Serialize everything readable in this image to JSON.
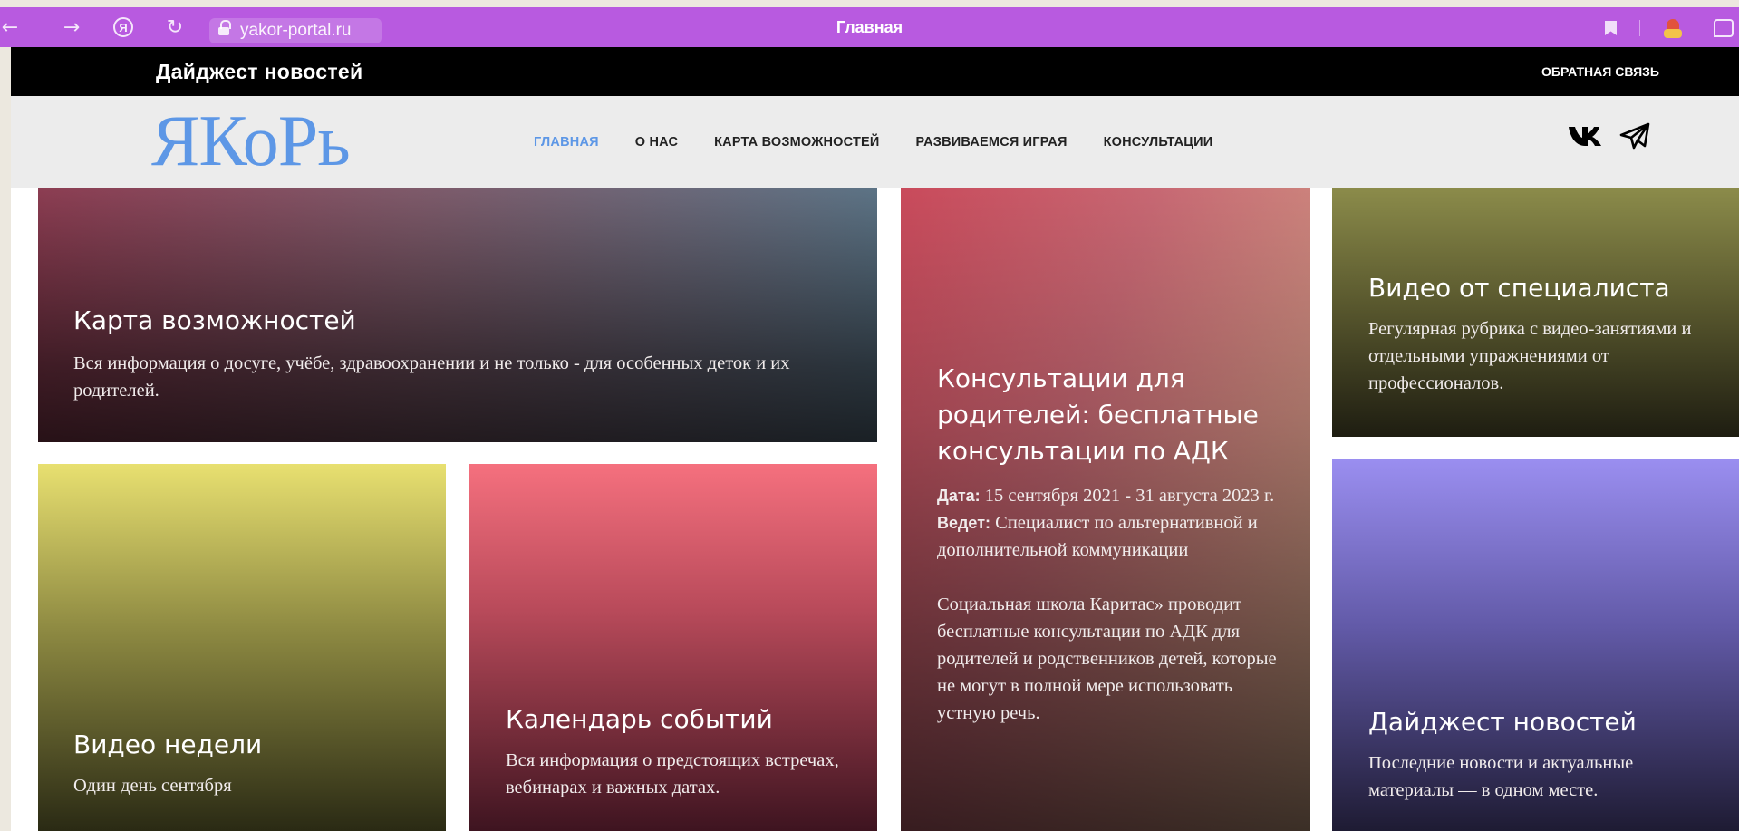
{
  "browser": {
    "url": "yakor-portal.ru",
    "tab_title": "Главная"
  },
  "topbar": {
    "title": "Дайджест новостей",
    "feedback": "ОБРАТНАЯ СВЯЗЬ"
  },
  "logo": "ЯКоРь",
  "nav": [
    {
      "label": "ГЛАВНАЯ",
      "active": true
    },
    {
      "label": "О НАС"
    },
    {
      "label": "КАРТА ВОЗМОЖНОСТЕЙ"
    },
    {
      "label": "РАЗВИВАЕМСЯ ИГРАЯ"
    },
    {
      "label": "КОНСУЛЬТАЦИИ"
    }
  ],
  "social": {
    "vk_label": "VK",
    "accent": "#5d97e6"
  },
  "cards": {
    "map": {
      "title": "Карта возможностей",
      "text": "Вся информация о досуге, учёбе, здравоохранении и не только - для особенных деток и их родителей."
    },
    "consult": {
      "title": "Консультации для родителей: бесплатные консультации по АДК",
      "date_label": "Дата:",
      "date_value": " 15 сентября 2021 - 31 августа 2023 г.",
      "host_label": "Ведет:",
      "host_value": " Специалист по альтернативной и дополнительной коммуникации",
      "description": "Социальная школа Каритас» проводит бесплатные консультации по АДК для родителей и родственников детей, которые не могут в полной мере использовать устную речь."
    },
    "video_spec": {
      "title": "Видео от специалиста",
      "text": "Регулярная рубрика с видео-занятиями и отдельными упражнениями от профессионалов."
    },
    "video_week": {
      "title": "Видео недели",
      "text": "Один день сентября"
    },
    "calendar": {
      "title": "Календарь событий",
      "text": "Вся информация о предстоящих встречах, вебинарах и важных датах."
    },
    "digest": {
      "title": "Дайджест новостей",
      "text": "Последние новости и актуальные материалы — в одном месте."
    }
  }
}
